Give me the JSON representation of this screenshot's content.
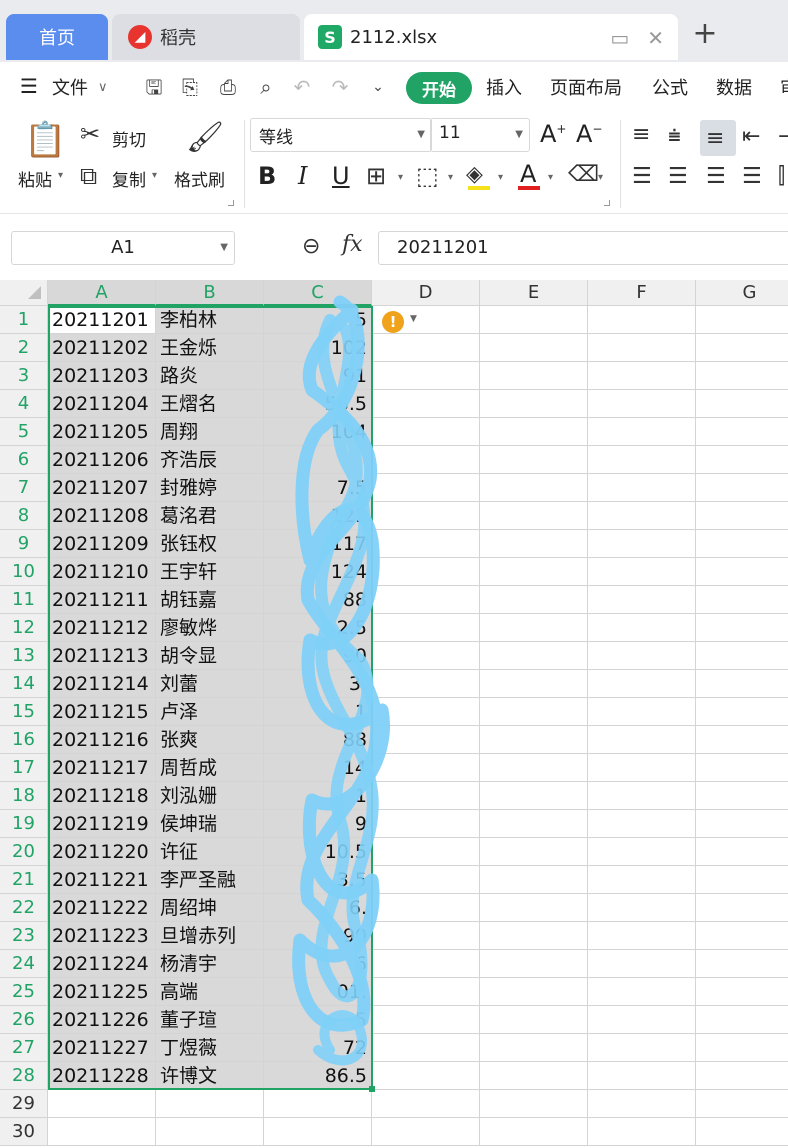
{
  "tabs": {
    "home": "首页",
    "docer": "稻壳",
    "file": "2112.xlsx",
    "file_icon": "S"
  },
  "menu": {
    "file": "文件",
    "start": "开始",
    "insert": "插入",
    "layout": "页面布局",
    "formula": "公式",
    "data": "数据",
    "review_partial": "审"
  },
  "ribbon": {
    "paste": "粘贴",
    "cut": "剪切",
    "copy": "复制",
    "format_painter": "格式刷",
    "font_name": "等线",
    "font_size": "11",
    "bold": "B",
    "italic": "I",
    "underline": "U",
    "font_color_letter": "A",
    "grow_font": "A",
    "shrink_font": "A"
  },
  "formula_bar": {
    "name_box": "A1",
    "fx": "fx",
    "value": "20211201"
  },
  "columns": [
    "A",
    "B",
    "C",
    "D",
    "E",
    "F",
    "G"
  ],
  "rows": [
    {
      "n": "1",
      "a": "20211201",
      "b": "李柏林",
      "c": "5"
    },
    {
      "n": "2",
      "a": "20211202",
      "b": "王金烁",
      "c": "102"
    },
    {
      "n": "3",
      "a": "20211203",
      "b": "路炎",
      "c": "91"
    },
    {
      "n": "4",
      "a": "20211204",
      "b": "王熠名",
      "c": "56.5"
    },
    {
      "n": "5",
      "a": "20211205",
      "b": "周翔",
      "c": "104"
    },
    {
      "n": "6",
      "a": "20211206",
      "b": "齐浩辰",
      "c": ""
    },
    {
      "n": "7",
      "a": "20211207",
      "b": "封雅婷",
      "c": "7.5"
    },
    {
      "n": "8",
      "a": "20211208",
      "b": "葛洺君",
      "c": "121"
    },
    {
      "n": "9",
      "a": "20211209",
      "b": "张钰权",
      "c": "117"
    },
    {
      "n": "10",
      "a": "20211210",
      "b": "王宇轩",
      "c": "124"
    },
    {
      "n": "11",
      "a": "20211211",
      "b": "胡钰嘉",
      "c": "88"
    },
    {
      "n": "12",
      "a": "20211212",
      "b": "廖敏烨",
      "c": "2.5"
    },
    {
      "n": "13",
      "a": "20211213",
      "b": "胡令显",
      "c": "90"
    },
    {
      "n": "14",
      "a": "20211214",
      "b": "刘蕾",
      "c": "3."
    },
    {
      "n": "15",
      "a": "20211215",
      "b": "卢泽",
      "c": "1"
    },
    {
      "n": "16",
      "a": "20211216",
      "b": "张爽",
      "c": "88"
    },
    {
      "n": "17",
      "a": "20211217",
      "b": "周哲成",
      "c": "14"
    },
    {
      "n": "18",
      "a": "20211218",
      "b": "刘泓姗",
      "c": "1"
    },
    {
      "n": "19",
      "a": "20211219",
      "b": "侯坤瑞",
      "c": "9"
    },
    {
      "n": "20",
      "a": "20211220",
      "b": "许征",
      "c": "10.5"
    },
    {
      "n": "21",
      "a": "20211221",
      "b": "李严圣融",
      "c": "3.5"
    },
    {
      "n": "22",
      "a": "20211222",
      "b": "周绍坤",
      "c": "6."
    },
    {
      "n": "23",
      "a": "20211223",
      "b": "旦增赤列",
      "c": "90"
    },
    {
      "n": "24",
      "a": "20211224",
      "b": "杨清宇",
      "c": "6"
    },
    {
      "n": "25",
      "a": "20211225",
      "b": "高端",
      "c": "01."
    },
    {
      "n": "26",
      "a": "20211226",
      "b": "董子瑄",
      "c": "5"
    },
    {
      "n": "27",
      "a": "20211227",
      "b": "丁煜薇",
      "c": "72"
    },
    {
      "n": "28",
      "a": "20211228",
      "b": "许博文",
      "c": "86.5"
    },
    {
      "n": "29",
      "a": "",
      "b": "",
      "c": ""
    },
    {
      "n": "30",
      "a": "",
      "b": "",
      "c": ""
    }
  ],
  "warning_icon": "!",
  "colors": {
    "accent_green": "#21a366",
    "tab_home_blue": "#5b8def",
    "scribble_blue": "#7fd0f8",
    "warning_orange": "#f0a21b"
  }
}
